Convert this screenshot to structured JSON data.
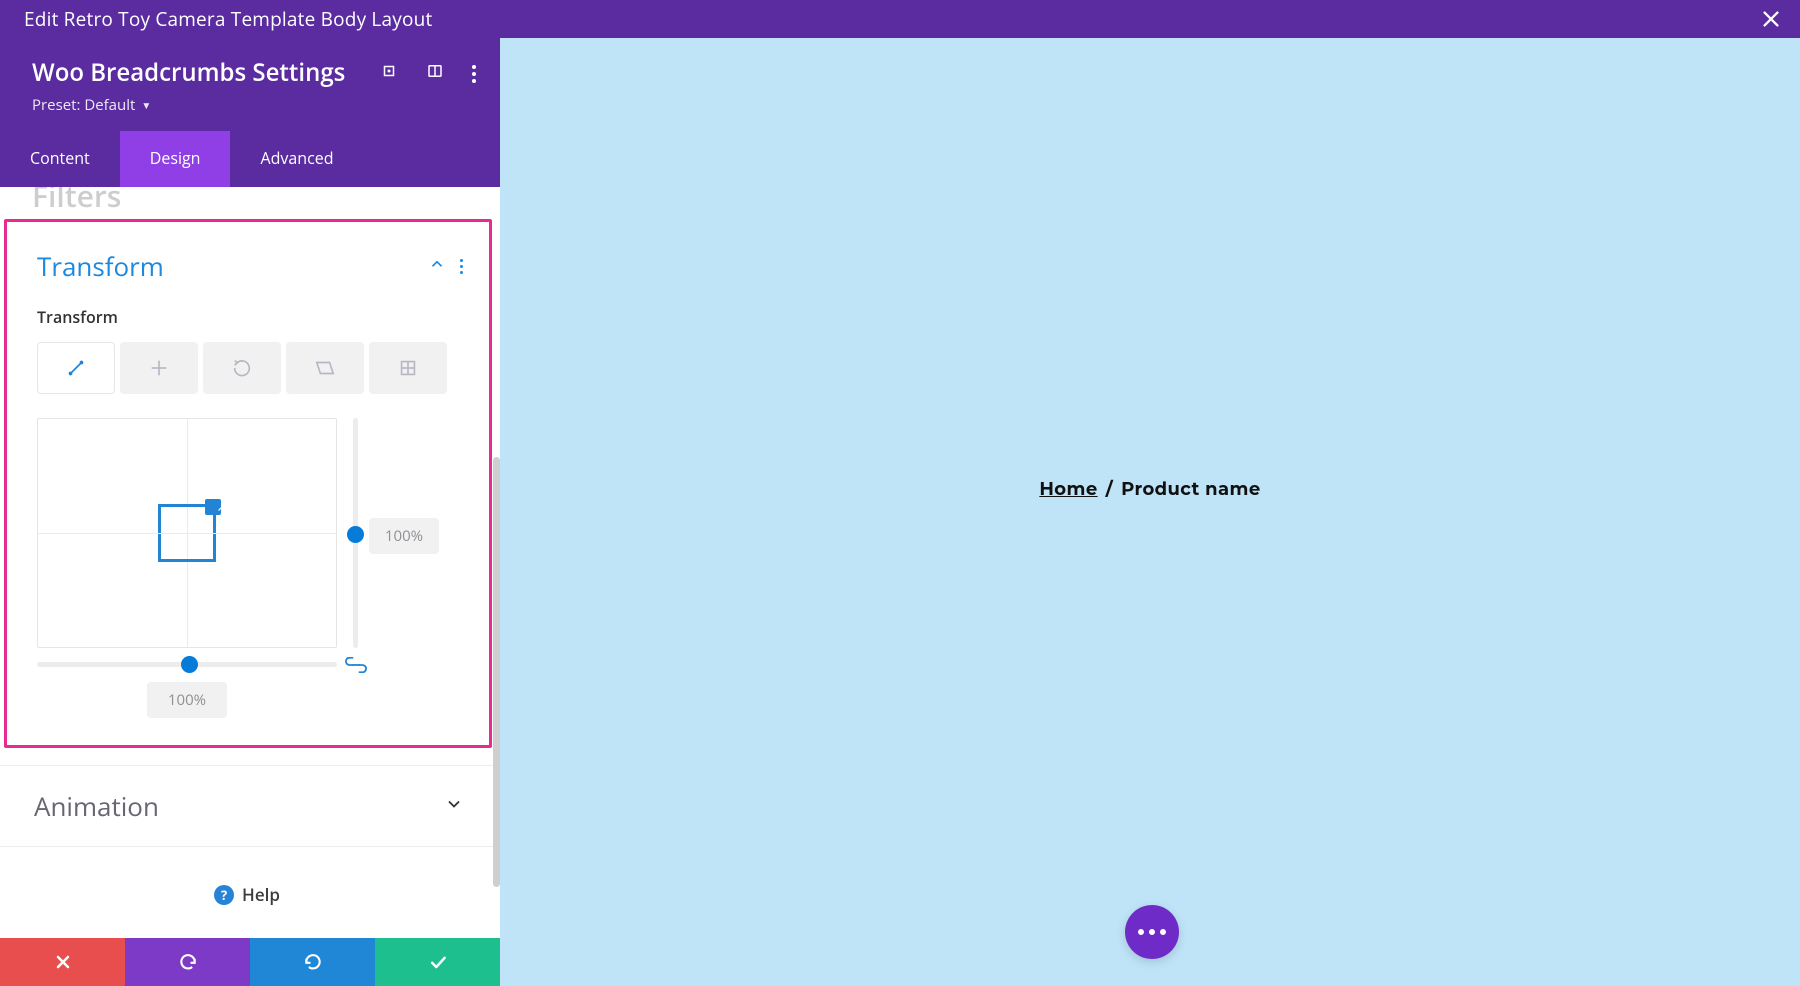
{
  "topbar": {
    "title": "Edit Retro Toy Camera Template Body Layout"
  },
  "panel": {
    "title": "Woo Breadcrumbs Settings",
    "preset_label": "Preset: Default"
  },
  "tabs": [
    {
      "label": "Content",
      "active": false
    },
    {
      "label": "Design",
      "active": true
    },
    {
      "label": "Advanced",
      "active": false
    }
  ],
  "peek_section": "Filters",
  "transform": {
    "title": "Transform",
    "label": "Transform",
    "v_value": "100%",
    "h_value": "100%"
  },
  "animation": {
    "title": "Animation"
  },
  "help": {
    "label": "Help"
  },
  "breadcrumb": {
    "home": "Home",
    "sep": "/",
    "current": "Product name"
  }
}
